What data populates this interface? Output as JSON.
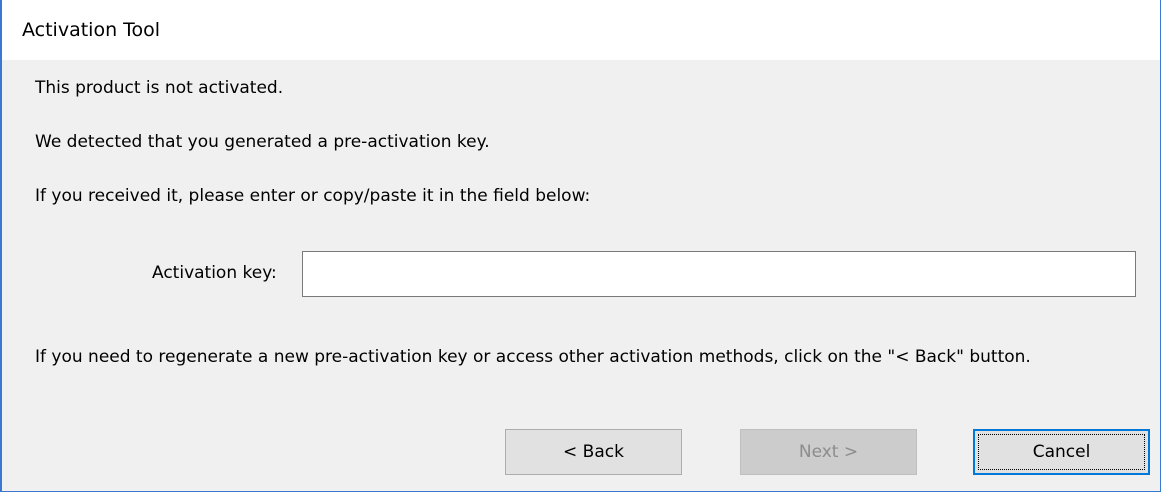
{
  "window": {
    "title": "Activation Tool"
  },
  "messages": {
    "not_activated": "This product is not activated.",
    "detected": "We detected that you generated a pre-activation key.",
    "instructions": "If you received it, please enter or copy/paste it in the field below:",
    "regenerate": "If you need to regenerate a new pre-activation key or access other activation methods, click on the \"< Back\" button."
  },
  "activation_key": {
    "label": "Activation key:",
    "value": "",
    "placeholder": ""
  },
  "buttons": {
    "back": "< Back",
    "next": "Next >",
    "cancel": "Cancel",
    "next_enabled": false
  },
  "colors": {
    "window_border": "#3a78d4",
    "dialog_bg": "#f0f0f0",
    "focus_accent": "#0078d7"
  }
}
